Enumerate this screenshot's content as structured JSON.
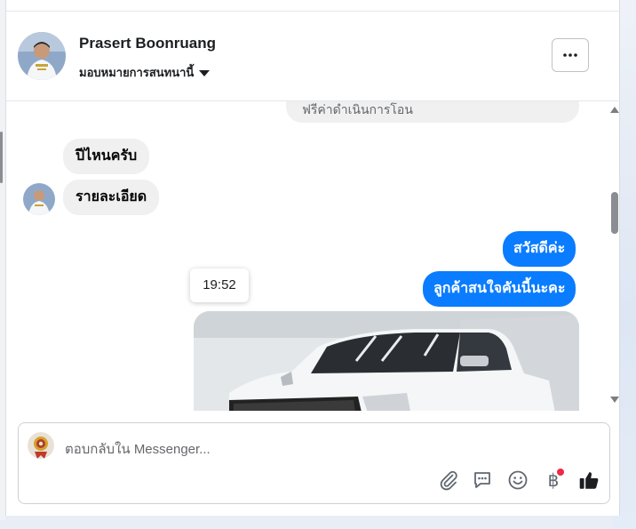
{
  "contact": {
    "name": "Prasert Boonruang",
    "assign_label": "มอบหมายการสนทนานี้"
  },
  "header": {
    "more_label": "···"
  },
  "messages": {
    "top_partial": "ฟรีค่าดำเนินการโอน",
    "incoming": [
      "ปีไหนครับ",
      "รายละเอียด"
    ],
    "outgoing": [
      "สวัสดีค่ะ",
      "ลูกค้าสนใจคันนี้นะคะ"
    ],
    "timestamp": "19:52"
  },
  "composer": {
    "placeholder": "ตอบกลับใน Messenger...",
    "currency_symbol": "฿"
  },
  "colors": {
    "outgoing_bubble": "#0a7cff",
    "incoming_bubble": "#f0f0f0",
    "notification_dot": "#f02849"
  },
  "icons": [
    "more-icon",
    "attach-icon",
    "saved-reply-icon",
    "emoji-icon",
    "baht-icon",
    "like-icon"
  ]
}
